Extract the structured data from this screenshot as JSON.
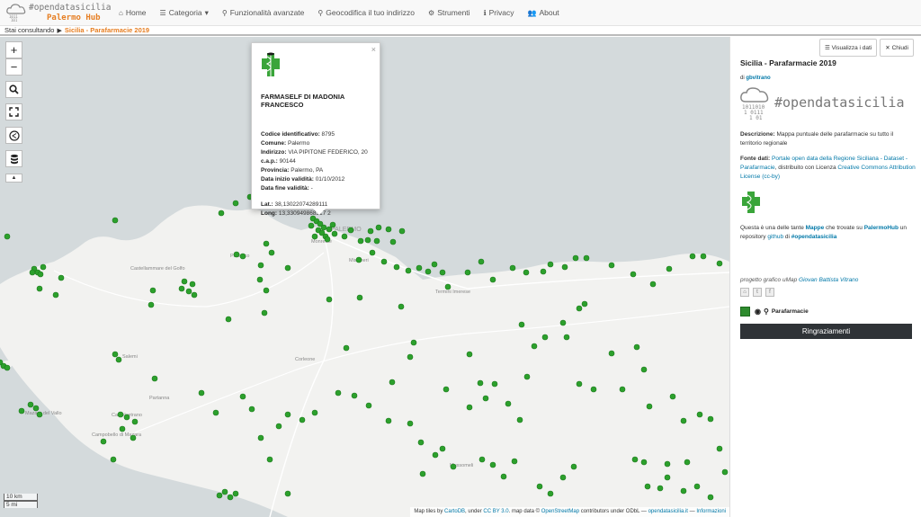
{
  "brand": {
    "title": "#opendatasicilia",
    "subtitle": "Palermo Hub"
  },
  "nav": [
    {
      "label": "Home",
      "icon": "home-icon",
      "glyph": "⌂"
    },
    {
      "label": "Categoria",
      "icon": "list-icon",
      "glyph": "☰",
      "caret": "▾"
    },
    {
      "label": "Funzionalità avanzate",
      "icon": "search-icon",
      "glyph": "⚲"
    },
    {
      "label": "Geocodifica il tuo indirizzo",
      "icon": "map-marker-icon",
      "glyph": "⚲"
    },
    {
      "label": "Strumenti",
      "icon": "gear-icon",
      "glyph": "⚙"
    },
    {
      "label": "Privacy",
      "icon": "info-icon",
      "glyph": "ℹ"
    },
    {
      "label": "About",
      "icon": "users-icon",
      "glyph": "👥"
    }
  ],
  "breadcrumb": {
    "prefix": "Stai consultando",
    "current": "Sicilia - Parafarmacie 2019"
  },
  "map": {
    "controls": [
      "+",
      "−"
    ],
    "scale": {
      "km": "10 km",
      "mi": "5 mi"
    },
    "place_names": [
      "Monreale",
      "PALERMO",
      "Misilmeri",
      "Castellammare del Golfo",
      "Partinico",
      "Corleone",
      "Salemi",
      "Partanna",
      "Castelvetrano",
      "Campobello di Mazara",
      "Termini Imerese",
      "Mussomeli",
      "Mazara del Vallo"
    ],
    "attribution": {
      "text1": "Map tiles by ",
      "link1": "CartoDB",
      "text2": ", under ",
      "link2": "CC BY 3.0",
      "text3": ". map data © ",
      "link3": "OpenStreetMap",
      "text4": " contributors under ODbL — ",
      "link4": "opendatasicilia.it",
      "text5": " — ",
      "link5": "Informazioni"
    },
    "marker_color": "#2ca02c"
  },
  "popup": {
    "title": "FARMASELF DI MADONIA FRANCESCO",
    "fields": [
      {
        "label": "Codice identificativo:",
        "value": "8795"
      },
      {
        "label": "Comune:",
        "value": "Palermo"
      },
      {
        "label": "Indirizzo:",
        "value": "VIA PIPITONE FEDERICO, 20"
      },
      {
        "label": "c.a.p.:",
        "value": "90144"
      },
      {
        "label": "Provincia:",
        "value": "Palermo, PA"
      },
      {
        "label": "Data inizio validità:",
        "value": "01/10/2012"
      },
      {
        "label": "Data fine validità:",
        "value": "-"
      }
    ],
    "coords": [
      {
        "label": "Lat.:",
        "value": "38,13022074289111"
      },
      {
        "label": "Long:",
        "value": "13,330949868317 2"
      }
    ]
  },
  "panel": {
    "btn_data": "Visualizza i dati",
    "btn_close": "Chiudi",
    "title": "Sicilia - Parafarmacie 2019",
    "by_prefix": "di",
    "by_author": "gbvitrano",
    "logo_text": "#opendatasicilia",
    "desc_label": "Descrizione:",
    "desc_text": "Mappa puntuale delle parafarmacie su tutto il territorio regionale",
    "fonte_label": "Fonte dati:",
    "fonte_link": "Portale open data della Regione Siciliana - Dataset - Parafarmacie",
    "fonte_mid": ", distribuito con Licenza ",
    "fonte_lic": "Creative Commons Attribution License (cc-by)",
    "info_1": "Questa è una delle tante ",
    "info_mappe": "Mappe",
    "info_2": " che trovate su ",
    "info_hub": "PalermoHub",
    "info_3": " un repository ",
    "info_github": "github",
    "info_4": " di ",
    "info_ods": "#opendatasicilia",
    "credit_prefix": "progetto grafico uMap ",
    "credit_name": "Giovan Battista Vitrano",
    "layer_name": "Parafarmacie",
    "thanks": "Ringraziamenti"
  }
}
